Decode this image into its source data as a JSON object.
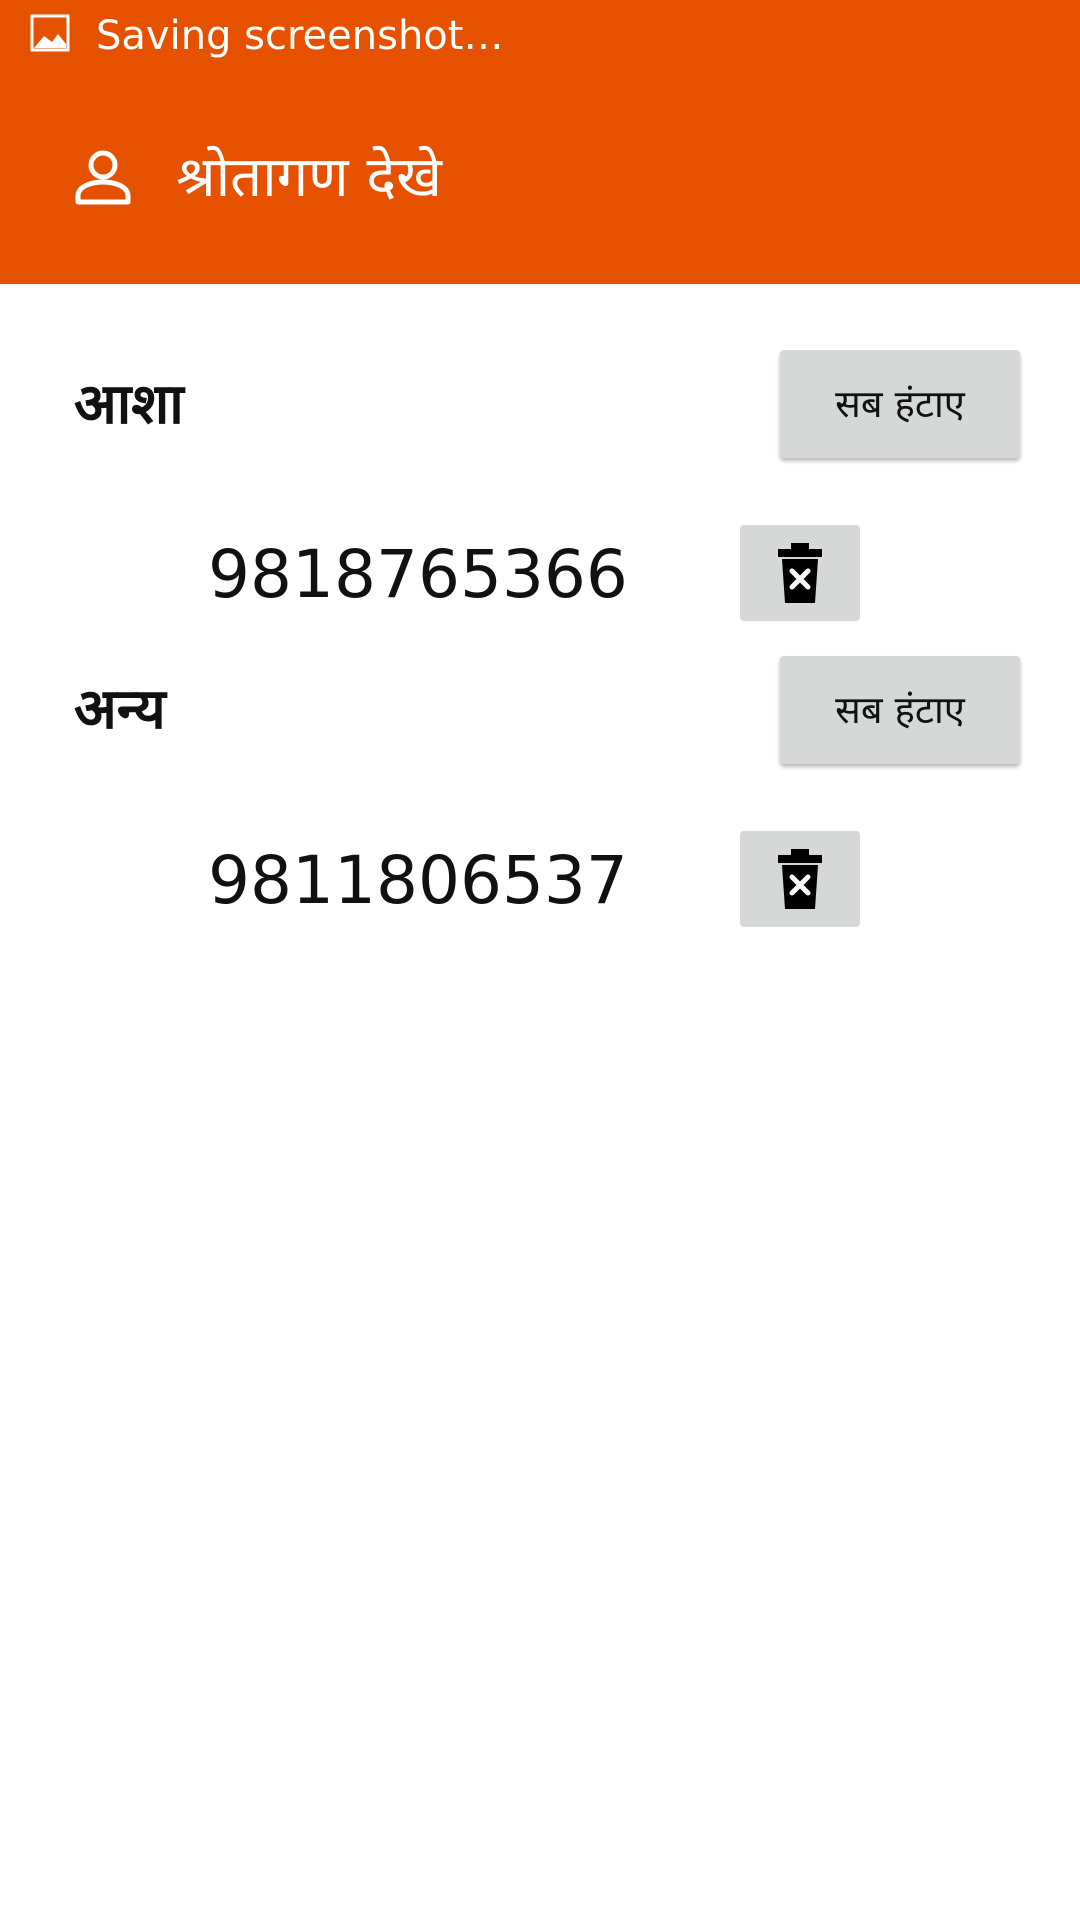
{
  "status_bar": {
    "text": "Saving screenshot…",
    "icon": "image-icon"
  },
  "toolbar": {
    "title": "श्रोतागण देखे",
    "icon": "person-icon",
    "color": "#E65100"
  },
  "groups": [
    {
      "title": "आशा",
      "remove_all_label": "सब हंटाए",
      "numbers": [
        "9818765366"
      ]
    },
    {
      "title": "अन्य",
      "remove_all_label": "सब हंटाए",
      "numbers": [
        "9811806537"
      ]
    }
  ],
  "colors": {
    "header": "#E65100",
    "button_bg": "#D6D7D7",
    "text": "#111111"
  }
}
